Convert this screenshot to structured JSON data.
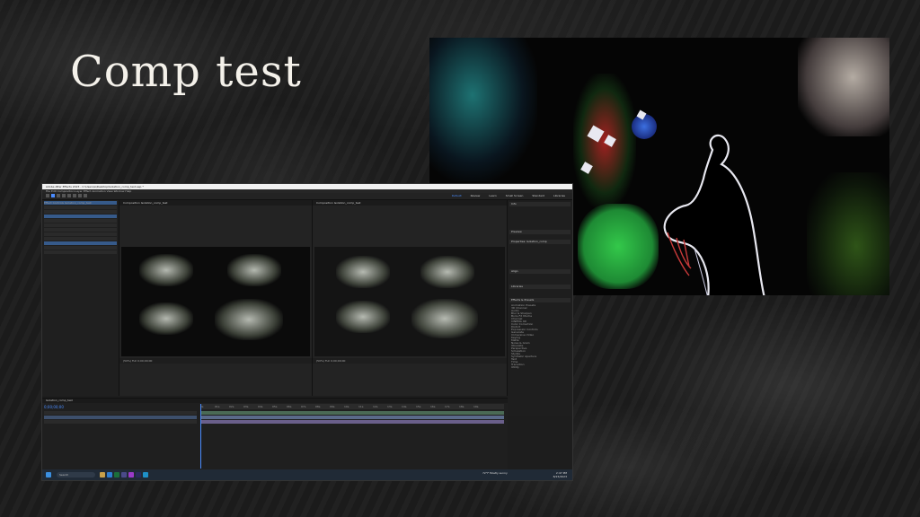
{
  "slide": {
    "title": "Comp test"
  },
  "ae_window": {
    "title": "Adobe After Effects 2023 - C:\\Users\\e\\Desktop\\Isolation_comp_test.aep *",
    "menu": "File  Edit  Composition  Layer  Effect  Animation  View  Window  Help",
    "workspaces": [
      "Default",
      "Review",
      "Learn",
      "Small Screen",
      "Standard",
      "Libraries"
    ],
    "active_workspace": "Default",
    "project_panel_title": "Effect Controls Isolation_comp_test",
    "comp_left_tab": "Composition Isolation_comp_test",
    "comp_left_tab_label": "Isolation_comp_test",
    "comp_right_tab": "Composition Isolation_comp_test",
    "comp_left_footer": "(50%)   Full   0;00;00;00",
    "comp_right_footer": "(50%)   Full   0;00;00;00",
    "right_sections": [
      "Info",
      "Preview",
      "Properties: Isolation_comp",
      "Align",
      "Libraries",
      "Effects & Presets"
    ],
    "effects_list": [
      "Animation Presets",
      "3D Channel",
      "Audio",
      "Blur & Sharpen",
      "Boris FX Mocha",
      "Channel",
      "CINEMA 4D",
      "Color Correction",
      "Distort",
      "Expression Controls",
      "Generate",
      "Immersive Video",
      "Keying",
      "Matte",
      "Noise & Grain",
      "Obsolete",
      "Perspective",
      "Simulation",
      "Stylize",
      "Synthetic Aperture",
      "Text",
      "Time",
      "Transition",
      "Utility"
    ],
    "timecode": "0;00;00;00",
    "timeline_tab": "Isolation_comp_test",
    "ruler_ticks": [
      "0s",
      "01s",
      "02s",
      "03s",
      "04s",
      "05s",
      "06s",
      "07s",
      "08s",
      "09s",
      "10s",
      "11s",
      "12s",
      "13s",
      "14s",
      "15s",
      "16s",
      "17s",
      "18s",
      "19s"
    ],
    "taskbar_search": "Search",
    "taskbar_weather": "72°F Mostly sunny",
    "taskbar_time": "2:47 PM",
    "taskbar_date": "8/15/2023"
  },
  "colors": {
    "accent_blue": "#4a8cff",
    "selection_blue": "#365a8a"
  }
}
